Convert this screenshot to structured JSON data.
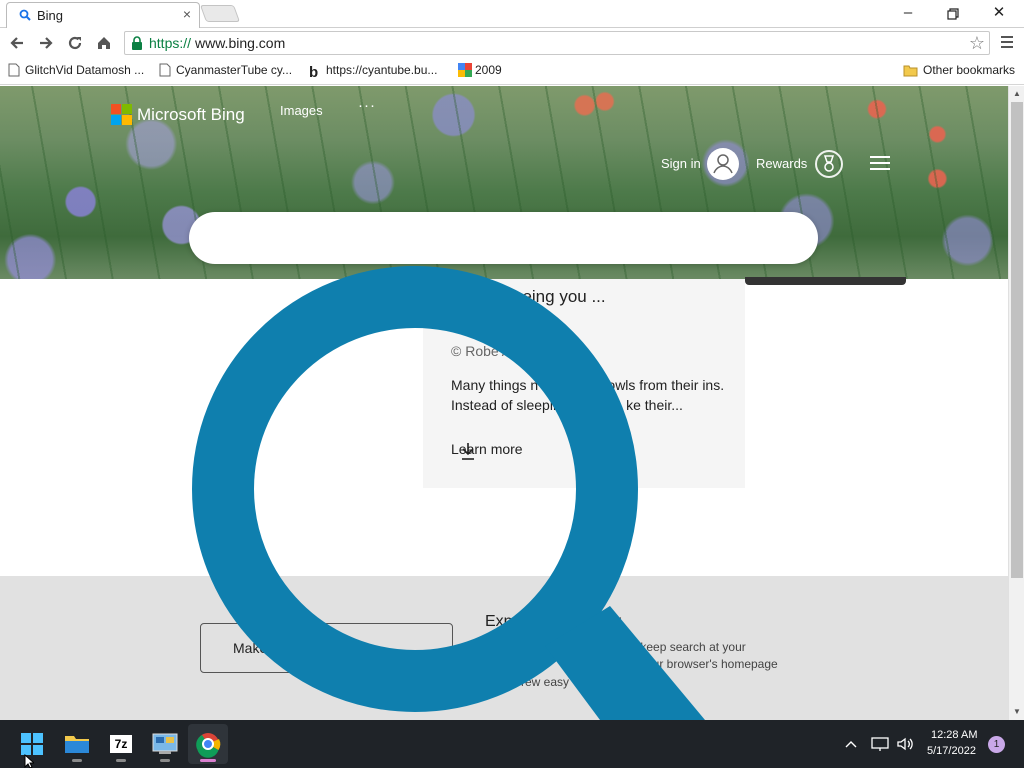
{
  "browser": {
    "tab_title": "Bing",
    "tab_favicon": "b",
    "tab_close": "×",
    "window_controls": {
      "minimize": "–",
      "restore": "❐",
      "close": "✕"
    },
    "url_scheme": "https://",
    "url_host": "www.bing.com",
    "bookmarks": [
      {
        "label": "GlitchVid Datamosh ..."
      },
      {
        "label": "CyanmasterTube cy..."
      },
      {
        "label": "https://cyantube.bu..."
      },
      {
        "label": "2009"
      }
    ],
    "other_bookmarks": "Other bookmarks"
  },
  "bing": {
    "logo_text": "Microsoft Bing",
    "nav_images": "Images",
    "nav_more": "···",
    "sign_in": "Sign in",
    "rewards": "Rewards",
    "card": {
      "title": "eeing you ...",
      "credit": "© Robe              Alamy",
      "description": "Many things              n burrowing owls from their           ins. Instead of sleeping in trees,           ke their...",
      "learn_more": "Learn more"
    },
    "footer": {
      "button_label": "Make                      ...age",
      "title": "Exp            auty every day",
      "sub1": "and keep search at your",
      "sub2": "your browser's homepage",
      "sub3": "rew easy"
    }
  },
  "taskbar": {
    "apps": [
      {
        "name": "start",
        "icon": "windows-icon"
      },
      {
        "name": "file-explorer",
        "icon": "folder-icon"
      },
      {
        "name": "7zip",
        "icon": "7z-icon",
        "label": "7z"
      },
      {
        "name": "control-panel",
        "icon": "control-panel-icon"
      },
      {
        "name": "chrome",
        "icon": "chrome-icon",
        "active": true
      }
    ],
    "time": "12:28 AM",
    "date": "5/17/2022",
    "notification_count": "1"
  },
  "colors": {
    "magnifier_blue": "#0f7fae",
    "url_green": "#0b8043",
    "taskbar_bg": "#1f2328"
  }
}
